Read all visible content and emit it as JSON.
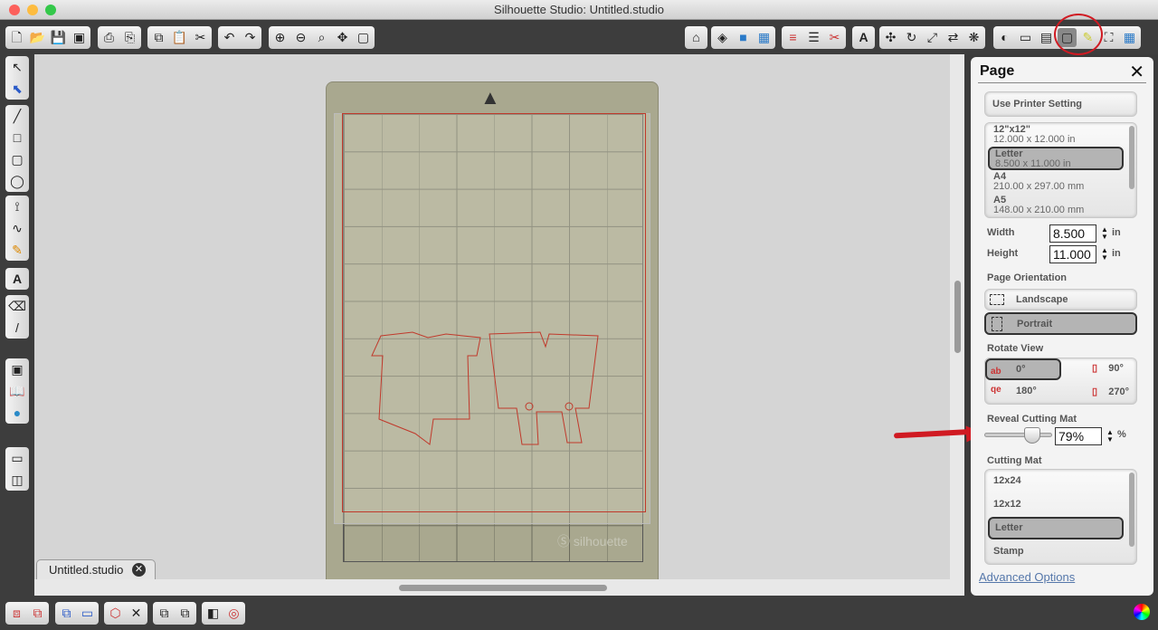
{
  "window": {
    "title": "Silhouette Studio: Untitled.studio"
  },
  "document_tab": {
    "label": "Untitled.studio",
    "close": "✕"
  },
  "panel": {
    "title": "Page",
    "close": "✕",
    "use_printer": "Use Printer Setting",
    "page_sizes": [
      {
        "name": "12\"x12\"",
        "dims": "12.000 x 12.000 in"
      },
      {
        "name": "Letter",
        "dims": "8.500 x 11.000 in",
        "selected": true
      },
      {
        "name": "A4",
        "dims": "210.00 x 297.00 mm"
      },
      {
        "name": "A5",
        "dims": "148.00 x 210.00 mm"
      }
    ],
    "width_label": "Width",
    "width_value": "8.500",
    "height_label": "Height",
    "height_value": "11.000",
    "unit": "in",
    "orientation_label": "Page Orientation",
    "landscape": "Landscape",
    "portrait": "Portrait",
    "orientation_selected": "Portrait",
    "rotate_label": "Rotate View",
    "rotations": [
      "0°",
      "90°",
      "180°",
      "270°"
    ],
    "rotation_selected": "0°",
    "reveal_label": "Reveal Cutting Mat",
    "reveal_value": "79%",
    "reveal_percent": 79,
    "percent_sign": "%",
    "cutting_mat_label": "Cutting Mat",
    "mats": [
      "12x24",
      "12x12",
      "Letter",
      "Stamp"
    ],
    "mat_selected": "Letter",
    "advanced": "Advanced Options"
  },
  "canvas": {
    "mat_logo": "silhouette",
    "cut_line_color": "#c0392b",
    "mat_color": "#a9a88f"
  }
}
